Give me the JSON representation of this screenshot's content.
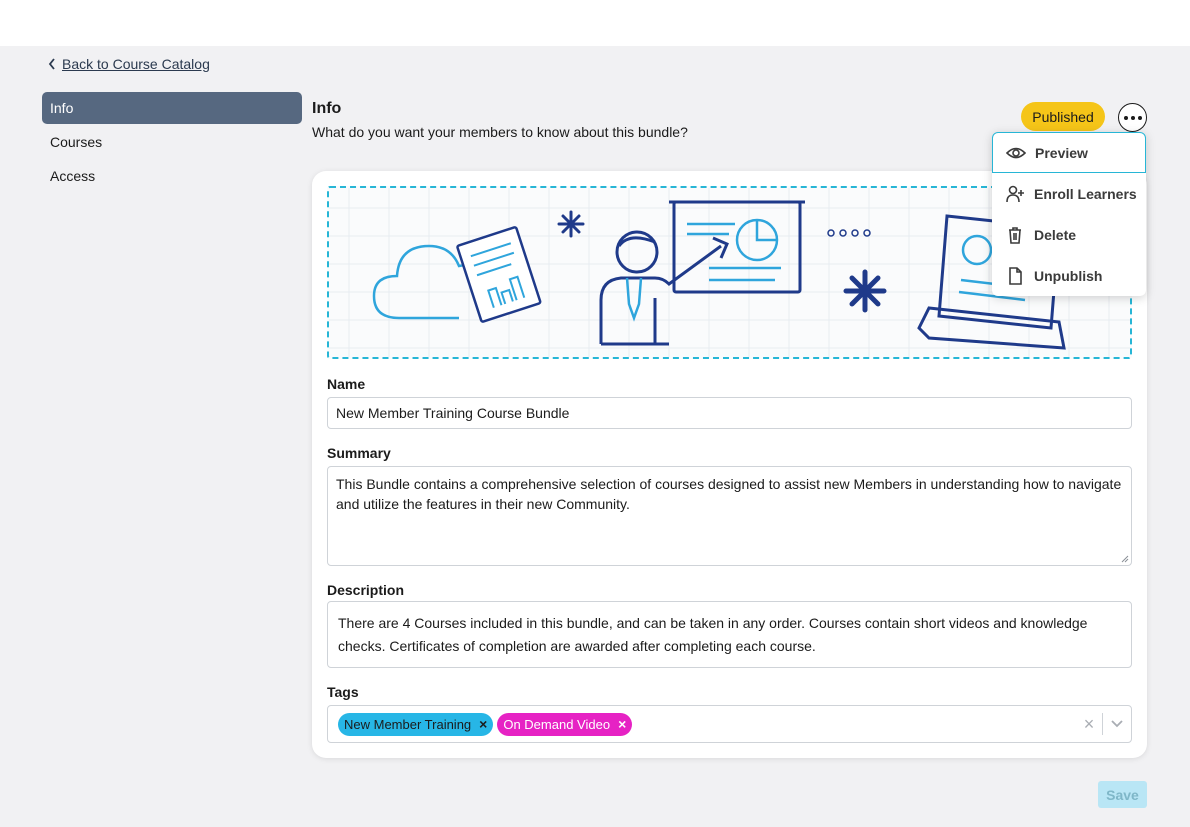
{
  "nav": {
    "back_label": "Back to Course Catalog",
    "items": [
      {
        "label": "Info",
        "active": true
      },
      {
        "label": "Courses",
        "active": false
      },
      {
        "label": "Access",
        "active": false
      }
    ]
  },
  "section": {
    "title": "Info",
    "subtitle": "What do you want your members to know about this bundle?"
  },
  "status": {
    "label": "Published",
    "color": "#f5c518"
  },
  "menu": {
    "items": [
      {
        "label": "Preview",
        "icon": "eye-icon"
      },
      {
        "label": "Enroll Learners",
        "icon": "add-user-icon"
      },
      {
        "label": "Delete",
        "icon": "trash-icon"
      },
      {
        "label": "Unpublish",
        "icon": "file-icon"
      }
    ]
  },
  "form": {
    "name": {
      "label": "Name",
      "value": "New Member Training Course Bundle"
    },
    "summary": {
      "label": "Summary",
      "value": "This Bundle contains a comprehensive selection of courses designed to assist new Members in understanding how to navigate and utilize the features in their new Community."
    },
    "description": {
      "label": "Description",
      "value": "There are 4 Courses included in this bundle, and can be taken in any order. Courses contain short videos and knowledge checks. Certificates of completion are awarded after completing each course."
    },
    "tags": {
      "label": "Tags",
      "items": [
        {
          "label": "New Member Training",
          "color": "#27b6e6"
        },
        {
          "label": "On Demand Video",
          "color": "#e622c4"
        }
      ],
      "remove_glyph": "×",
      "clear_glyph": "×"
    },
    "save_label": "Save"
  },
  "colors": {
    "accent": "#27b6d6",
    "nav_active": "#566880",
    "illustration_navy": "#1f3a8a",
    "illustration_blue": "#2fa5dc"
  }
}
